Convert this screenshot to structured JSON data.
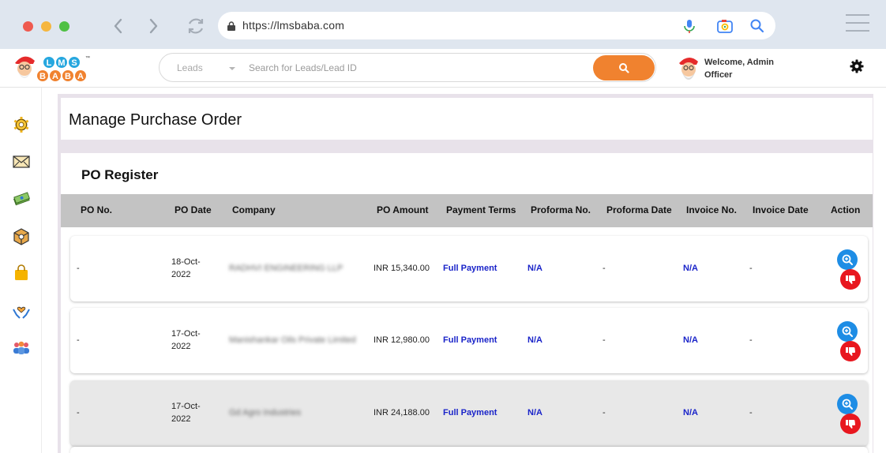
{
  "browser": {
    "url": "https://lmsbaba.com"
  },
  "header": {
    "logo_letters_top": "LMS",
    "logo_letters_bottom": "BABA",
    "logo_tm": "™",
    "search_category": "Leads",
    "search_placeholder": "Search for Leads/Lead ID",
    "welcome_line1": "Welcome, Admin",
    "welcome_line2": "Officer"
  },
  "page": {
    "title": "Manage Purchase Order",
    "register_title": "PO Register"
  },
  "table": {
    "columns": [
      "PO No.",
      "PO Date",
      "Company",
      "PO Amount",
      "Payment Terms",
      "Proforma No.",
      "Proforma Date",
      "Invoice No.",
      "Invoice Date",
      "Action"
    ],
    "rows": [
      {
        "po_no": "-",
        "po_date_1": "18-Oct-",
        "po_date_2": "2022",
        "company": "RADHVI ENGINEERING LLP",
        "amount": "INR 15,340.00",
        "payment_terms": "Full Payment",
        "proforma_no": "N/A",
        "proforma_date": "-",
        "invoice_no": "N/A",
        "invoice_date": "-"
      },
      {
        "po_no": "-",
        "po_date_1": "17-Oct-",
        "po_date_2": "2022",
        "company": "Manishankar Oils Private Limited",
        "amount": "INR 12,980.00",
        "payment_terms": "Full Payment",
        "proforma_no": "N/A",
        "proforma_date": "-",
        "invoice_no": "N/A",
        "invoice_date": "-"
      },
      {
        "po_no": "-",
        "po_date_1": "17-Oct-",
        "po_date_2": "2022",
        "company": "Gd Agro Industries",
        "amount": "INR 24,188.00",
        "payment_terms": "Full Payment",
        "proforma_no": "N/A",
        "proforma_date": "-",
        "invoice_no": "N/A",
        "invoice_date": "-"
      }
    ]
  },
  "colors": {
    "accent_orange": "#f0822f",
    "link_blue": "#1a24c9",
    "view_blue": "#1e8de5",
    "reject_red": "#e8171f"
  },
  "sidebar_icons": [
    "settings-gear-icon",
    "mail-icon",
    "money-icon",
    "box-icon",
    "shopping-bag-icon",
    "care-hands-icon",
    "team-icon"
  ]
}
